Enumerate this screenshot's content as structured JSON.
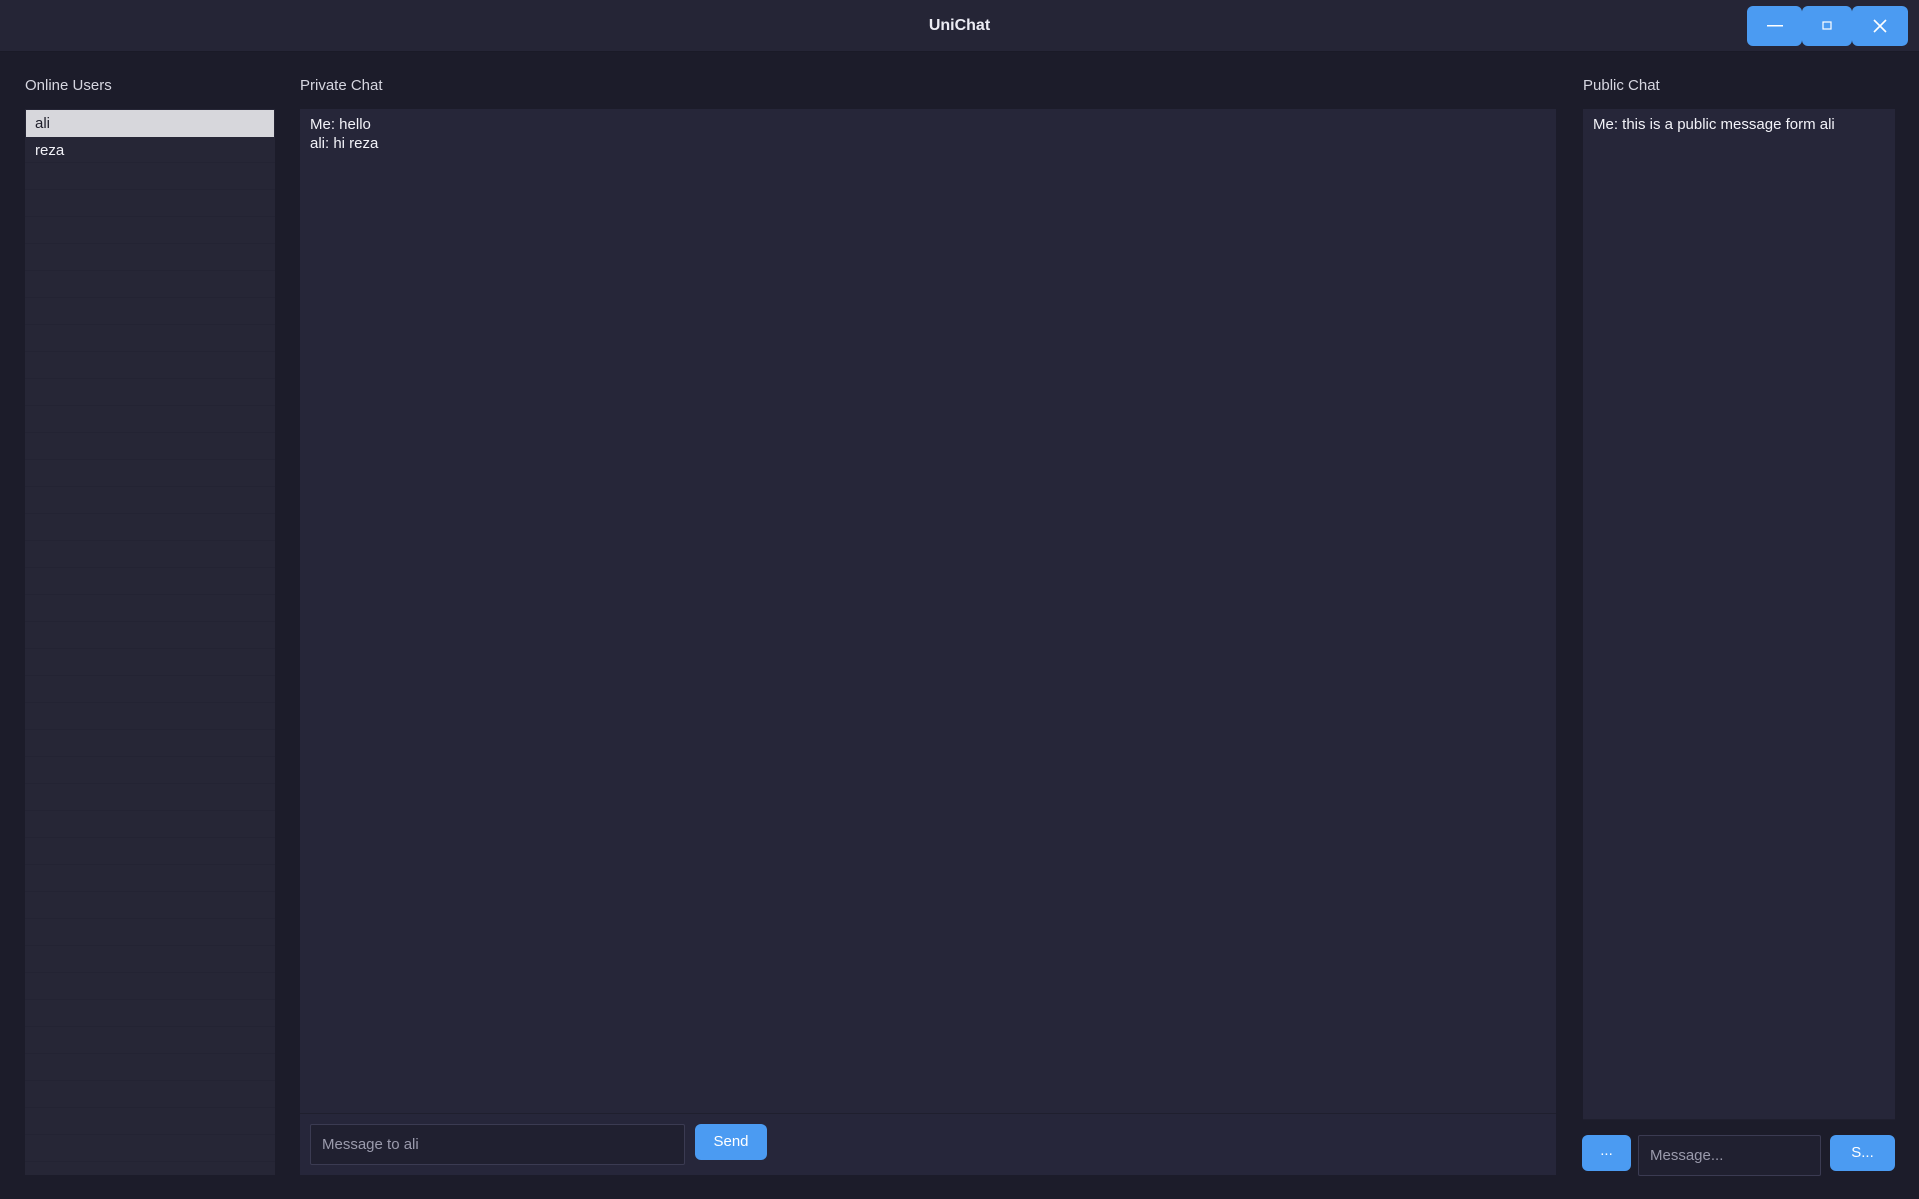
{
  "window": {
    "title": "UniChat",
    "controls": {
      "minimize_icon": "minimize-icon",
      "maximize_icon": "maximize-icon",
      "close_icon": "close-icon"
    },
    "accent_color": "#4b9bf2",
    "background_color": "#1c1c2a"
  },
  "users": {
    "label": "Online Users",
    "items": [
      {
        "name": "ali",
        "selected": true
      },
      {
        "name": "reza",
        "selected": false
      }
    ]
  },
  "private_chat": {
    "label": "Private Chat",
    "messages": [
      "Me: hello",
      "ali: hi reza"
    ],
    "input_placeholder": "Message to ali",
    "send_label": "Send"
  },
  "public_chat": {
    "label": "Public Chat",
    "messages": [
      "Me: this is a public message form ali"
    ],
    "more_label": "...",
    "input_placeholder": "Message...",
    "send_label": "S..."
  }
}
